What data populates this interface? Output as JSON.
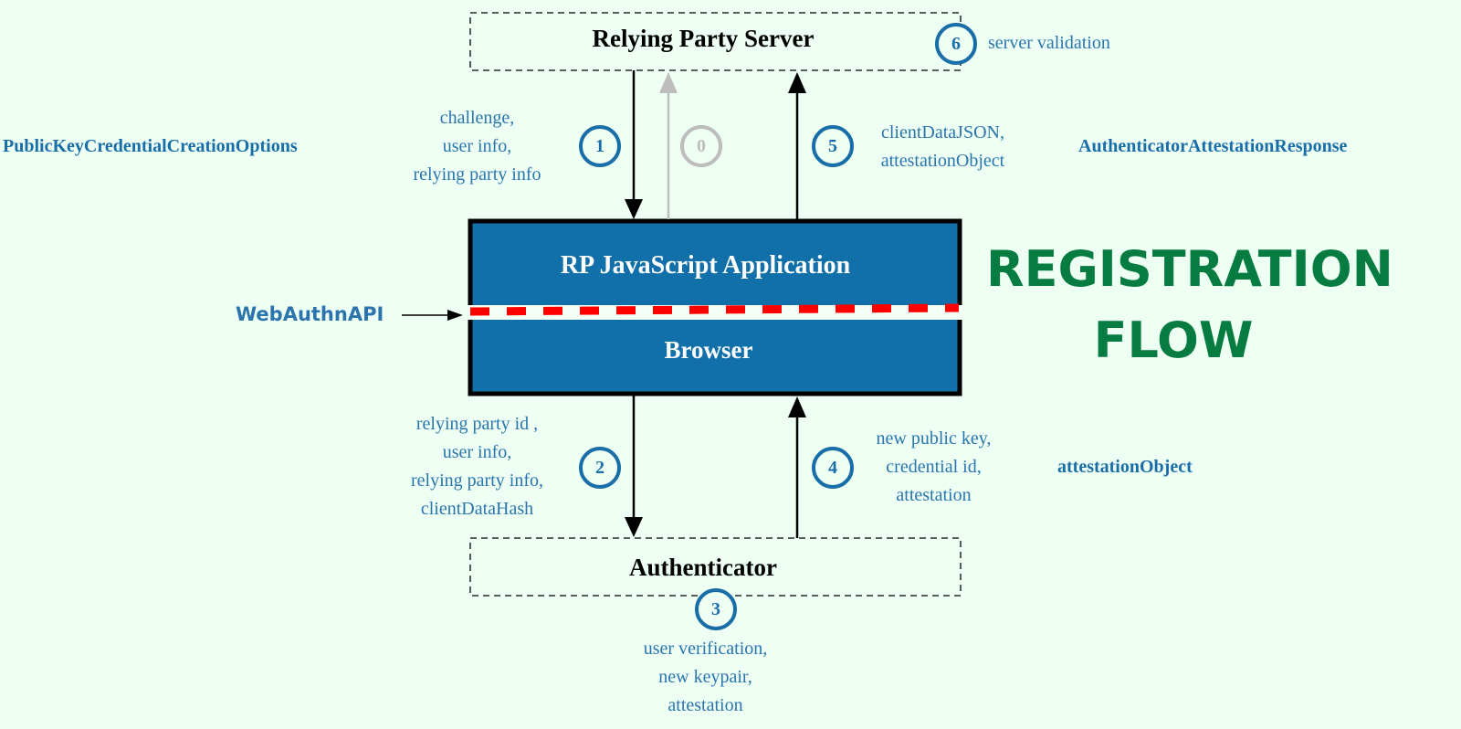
{
  "title": {
    "line1": "REGISTRATION",
    "line2": "FLOW",
    "color": "#067c41"
  },
  "nodes": {
    "relying_party_server": "Relying Party Server",
    "rp_js_app": "RP JavaScript Application",
    "browser": "Browser",
    "authenticator": "Authenticator"
  },
  "api_label": "WebAuthnAPI",
  "types": {
    "creation_options": "PublicKeyCredentialCreationOptions",
    "attestation_response": "AuthenticatorAttestationResponse",
    "attestation_object": "attestationObject"
  },
  "steps": [
    {
      "number": "0",
      "style": "inactive",
      "lines": []
    },
    {
      "number": "1",
      "style": "active",
      "lines": [
        "challenge,",
        "user info,",
        "relying party info"
      ]
    },
    {
      "number": "2",
      "style": "active",
      "lines": [
        "relying party id ,",
        "user info,",
        "relying party info,",
        "clientDataHash"
      ]
    },
    {
      "number": "3",
      "style": "active",
      "lines": [
        "user verification,",
        "new keypair,",
        "attestation"
      ]
    },
    {
      "number": "4",
      "style": "active",
      "lines": [
        "new public key,",
        "credential id,",
        "attestation"
      ]
    },
    {
      "number": "5",
      "style": "active",
      "lines": [
        "clientDataJSON,",
        "attestationObject"
      ]
    },
    {
      "number": "6",
      "style": "active",
      "lines": [
        "server validation"
      ]
    }
  ],
  "colors": {
    "background": "#eefff3",
    "box_fill": "#1170a9",
    "step_accent": "#1a6ea8",
    "step_inactive": "#bdbdbd",
    "api_boundary": "#ff0000"
  }
}
